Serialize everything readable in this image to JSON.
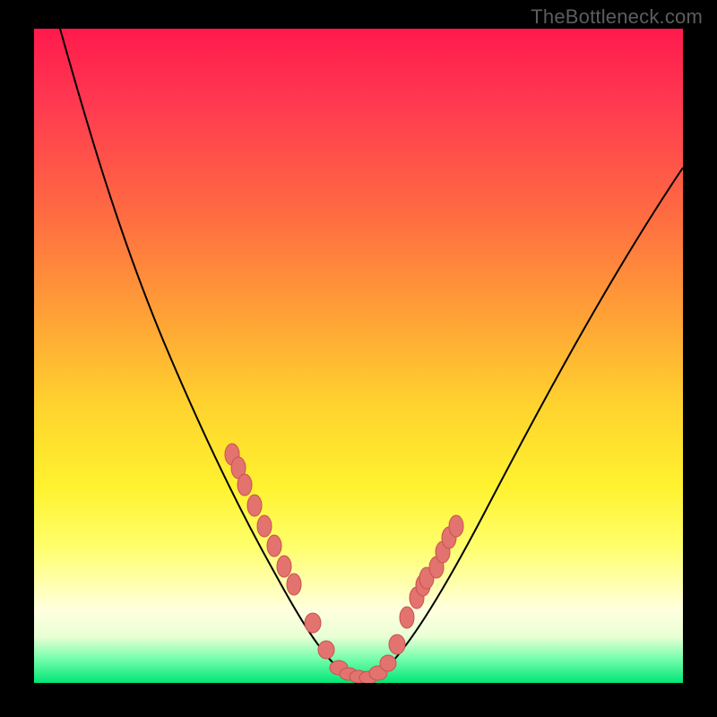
{
  "watermark": "TheBottleneck.com",
  "chart_data": {
    "type": "line",
    "title": "",
    "xlabel": "",
    "ylabel": "",
    "xlim": [
      0,
      100
    ],
    "ylim": [
      0,
      100
    ],
    "series": [
      {
        "name": "curve",
        "x": [
          4,
          8,
          12,
          16,
          20,
          24,
          27,
          30,
          33,
          36,
          39,
          41,
          43,
          45,
          47,
          49,
          51,
          53,
          55,
          58,
          62,
          66,
          70,
          75,
          80,
          85,
          90,
          95,
          100
        ],
        "y": [
          100,
          87,
          76,
          66,
          57,
          49,
          42,
          36,
          30,
          24,
          18,
          14,
          10,
          6,
          3,
          1,
          1,
          2,
          5,
          10,
          17,
          24,
          31,
          39,
          47,
          55,
          63,
          71,
          79
        ]
      }
    ],
    "markers": {
      "name": "highlighted-points",
      "x": [
        30.5,
        31.5,
        32.5,
        34,
        35.5,
        37,
        38.5,
        40,
        43,
        45,
        47,
        48.5,
        50,
        51.5,
        53,
        54.5,
        56,
        57.5,
        59,
        60,
        60.5,
        62,
        63,
        64,
        65
      ],
      "y": [
        35,
        33,
        30,
        27,
        24,
        21,
        18,
        15,
        9,
        5,
        2.5,
        1.3,
        0.9,
        0.8,
        1.5,
        3,
        6,
        10,
        13,
        15,
        16,
        18,
        20,
        22,
        24
      ]
    },
    "gradient_stops": [
      {
        "pos": 0,
        "color": "#ff1a4d"
      },
      {
        "pos": 12,
        "color": "#ff3b50"
      },
      {
        "pos": 28,
        "color": "#ff6a42"
      },
      {
        "pos": 44,
        "color": "#ffa236"
      },
      {
        "pos": 58,
        "color": "#ffd42e"
      },
      {
        "pos": 70,
        "color": "#fff22f"
      },
      {
        "pos": 79,
        "color": "#ffff6a"
      },
      {
        "pos": 85,
        "color": "#ffffb0"
      },
      {
        "pos": 89,
        "color": "#ffffe0"
      },
      {
        "pos": 93,
        "color": "#e8ffd4"
      },
      {
        "pos": 96,
        "color": "#7fffb0"
      },
      {
        "pos": 100,
        "color": "#00e676"
      }
    ]
  }
}
